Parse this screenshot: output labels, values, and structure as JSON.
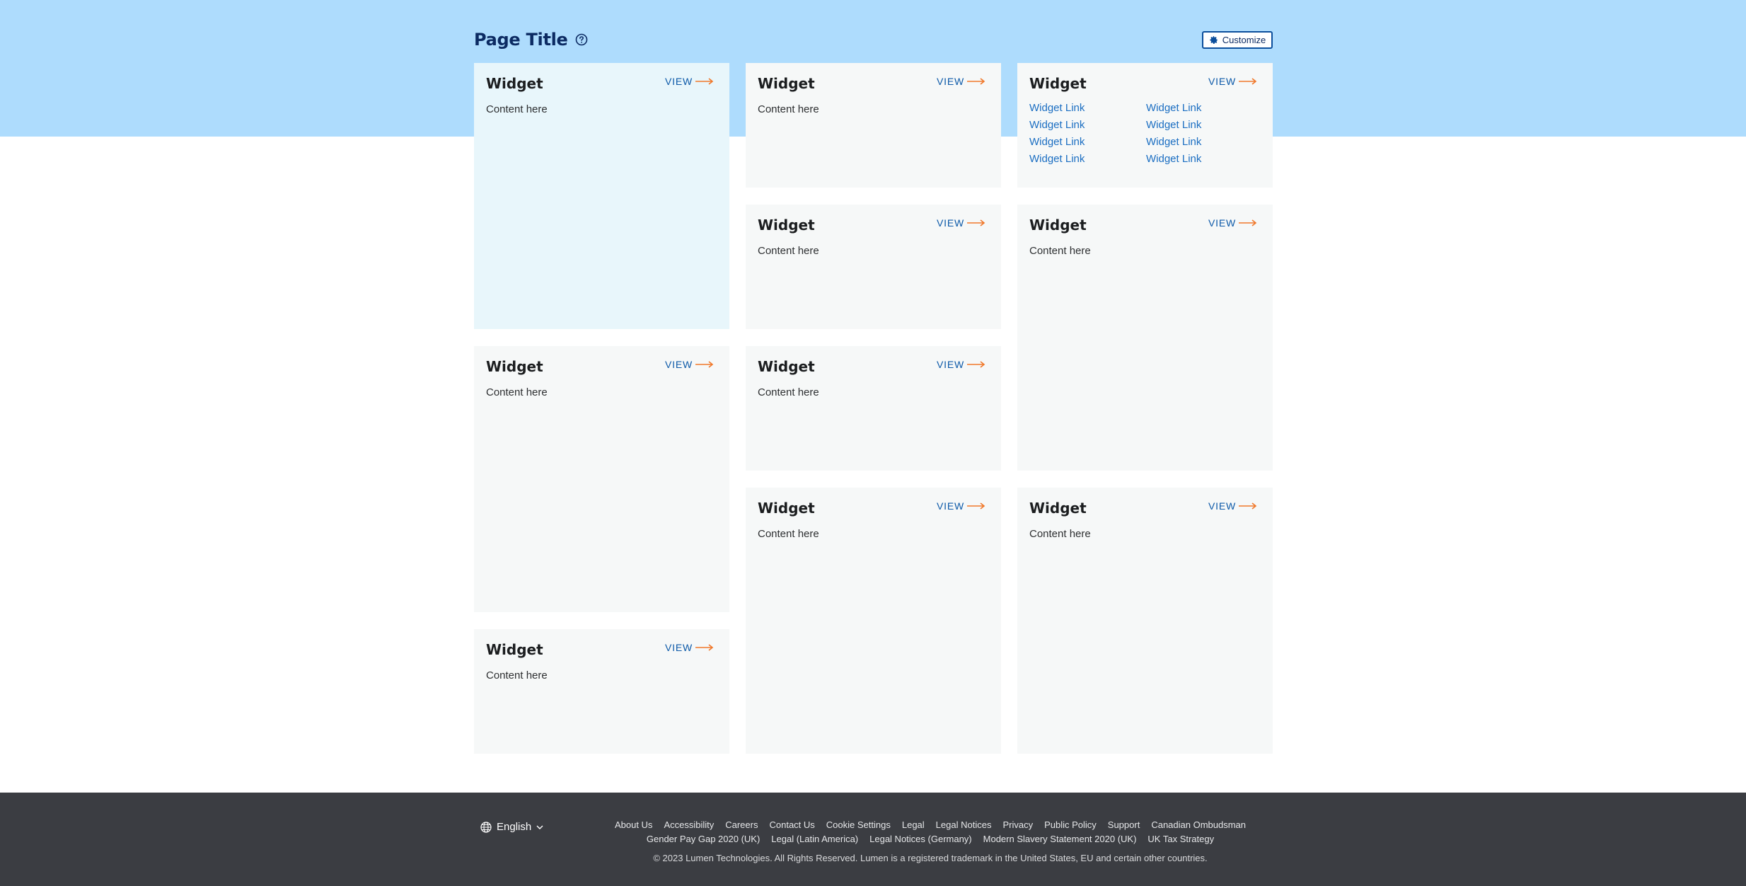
{
  "header": {
    "title": "Page Title",
    "customize_label": "Customize"
  },
  "widgets": [
    {
      "title": "Widget",
      "view": "VIEW",
      "content": "Content here"
    },
    {
      "title": "Widget",
      "view": "VIEW",
      "content": "Content here"
    },
    {
      "title": "Widget",
      "view": "VIEW",
      "links": [
        "Widget Link",
        "Widget Link",
        "Widget Link",
        "Widget Link",
        "Widget Link",
        "Widget Link",
        "Widget Link",
        "Widget Link"
      ]
    },
    {
      "title": "Widget",
      "view": "VIEW",
      "content": "Content here"
    },
    {
      "title": "Widget",
      "view": "VIEW",
      "content": "Content here"
    },
    {
      "title": "Widget",
      "view": "VIEW",
      "content": "Content here"
    },
    {
      "title": "Widget",
      "view": "VIEW",
      "content": "Content here"
    },
    {
      "title": "Widget",
      "view": "VIEW",
      "content": "Content here"
    },
    {
      "title": "Widget",
      "view": "VIEW",
      "content": "Content here"
    },
    {
      "title": "Widget",
      "view": "VIEW",
      "content": "Content here"
    }
  ],
  "footer": {
    "language": "English",
    "links_row1": [
      "About Us",
      "Accessibility",
      "Careers",
      "Contact Us",
      "Cookie Settings",
      "Legal",
      "Legal Notices",
      "Privacy",
      "Public Policy",
      "Support",
      "Canadian Ombudsman"
    ],
    "links_row2": [
      "Gender Pay Gap 2020 (UK)",
      "Legal (Latin America)",
      "Legal Notices (Germany)",
      "Modern Slavery Statement 2020 (UK)",
      "UK Tax Strategy"
    ],
    "copyright": "© 2023 Lumen Technologies. All Rights Reserved. Lumen is a registered trademark in the United States, EU and certain other countries."
  },
  "colors": {
    "hero": "#aedcfd",
    "title": "#0c2b63",
    "link": "#0c59a8",
    "arrow": "#f0782a",
    "footer": "#3b3d42"
  }
}
